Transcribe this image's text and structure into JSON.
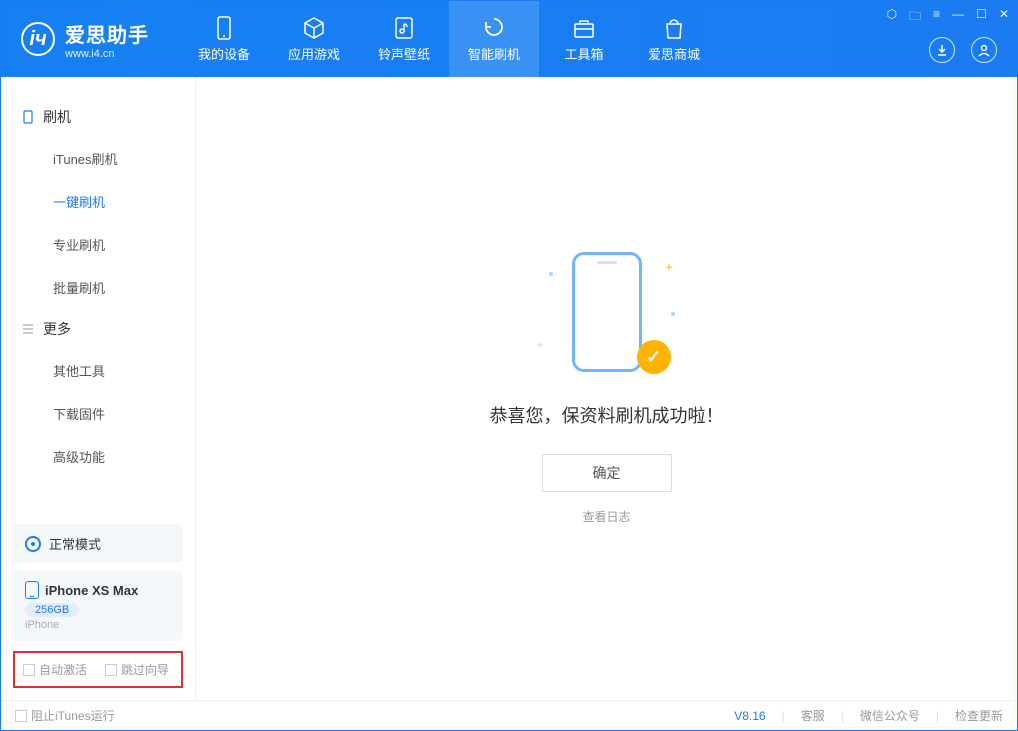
{
  "app": {
    "title": "爱思助手",
    "subtitle": "www.i4.cn"
  },
  "nav": {
    "tabs": [
      {
        "label": "我的设备"
      },
      {
        "label": "应用游戏"
      },
      {
        "label": "铃声壁纸"
      },
      {
        "label": "智能刷机"
      },
      {
        "label": "工具箱"
      },
      {
        "label": "爱思商城"
      }
    ]
  },
  "sidebar": {
    "section1_title": "刷机",
    "items1": [
      {
        "label": "iTunes刷机"
      },
      {
        "label": "一键刷机"
      },
      {
        "label": "专业刷机"
      },
      {
        "label": "批量刷机"
      }
    ],
    "section2_title": "更多",
    "items2": [
      {
        "label": "其他工具"
      },
      {
        "label": "下载固件"
      },
      {
        "label": "高级功能"
      }
    ],
    "mode_label": "正常模式",
    "device_name": "iPhone XS Max",
    "device_storage": "256GB",
    "device_type": "iPhone",
    "cb_auto_activate": "自动激活",
    "cb_skip_guide": "跳过向导"
  },
  "main": {
    "success_text": "恭喜您，保资料刷机成功啦！",
    "ok_label": "确定",
    "log_link": "查看日志"
  },
  "footer": {
    "block_itunes": "阻止iTunes运行",
    "version": "V8.16",
    "link_service": "客服",
    "link_wechat": "微信公众号",
    "link_update": "检查更新"
  }
}
